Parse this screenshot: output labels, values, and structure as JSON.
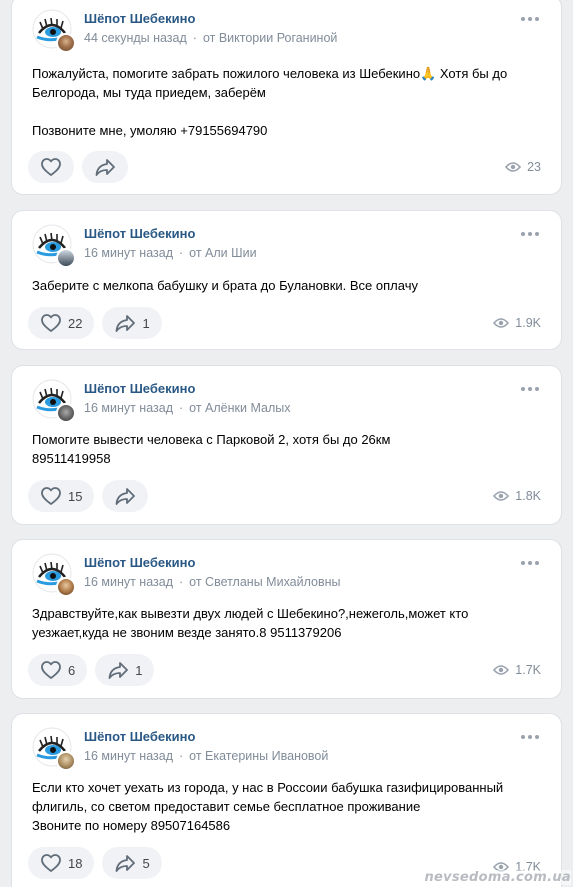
{
  "posts": [
    {
      "group": "Шёпот Шебекино",
      "time": "44 секунды назад",
      "author": "от Виктории Роганиной",
      "lines": [
        "Пожалуйста, помогите забрать пожилого человека из Шебекино🙏 Хотя бы до",
        "Белгорода, мы туда приедем, заберём",
        "",
        "Позвоните мне, умоляю +79155694790"
      ],
      "likes": "",
      "shares": "",
      "views": "23"
    },
    {
      "group": "Шёпот Шебекино",
      "time": "16 минут назад",
      "author": "от Али Шии",
      "lines": [
        "Заберите с мелкопа бабушку и брата до Булановки. Все оплачу"
      ],
      "likes": "22",
      "shares": "1",
      "views": "1.9K"
    },
    {
      "group": "Шёпот Шебекино",
      "time": "16 минут назад",
      "author": "от Алёнки Малых",
      "lines": [
        "Помогите вывести человека с Парковой 2, хотя бы до 26км",
        "89511419958"
      ],
      "likes": "15",
      "shares": "",
      "views": "1.8K"
    },
    {
      "group": "Шёпот Шебекино",
      "time": "16 минут назад",
      "author": "от Светланы Михайловны",
      "lines": [
        "Здравствуйте,как вывезти двух людей с Шебекино?,нежеголь,может кто",
        "уезжает,куда не звоним везде занято.8 9511379206"
      ],
      "likes": "6",
      "shares": "1",
      "views": "1.7K"
    },
    {
      "group": "Шёпот Шебекино",
      "time": "16 минут назад",
      "author": "от Екатерины Ивановой",
      "lines": [
        "Если кто хочет уехать из города, у нас в Россоии бабушка газифицированный",
        "флигиль, со светом предоставит семье бесплатное проживание",
        "Звоните по номеру 89507164586"
      ],
      "likes": "18",
      "shares": "5",
      "views": "1.7K"
    }
  ],
  "watermark": "nevsedoma.com.ua",
  "colors": {
    "background": "#edeef0",
    "card": "#ffffff",
    "group_link": "#2a5885",
    "secondary_text": "#818c99",
    "pill": "#f0f2f5"
  },
  "icons": {
    "avatar": "eye-logo-icon",
    "more": "more-dots-icon",
    "like": "heart-icon",
    "share": "share-arrow-icon",
    "views": "eye-icon"
  }
}
